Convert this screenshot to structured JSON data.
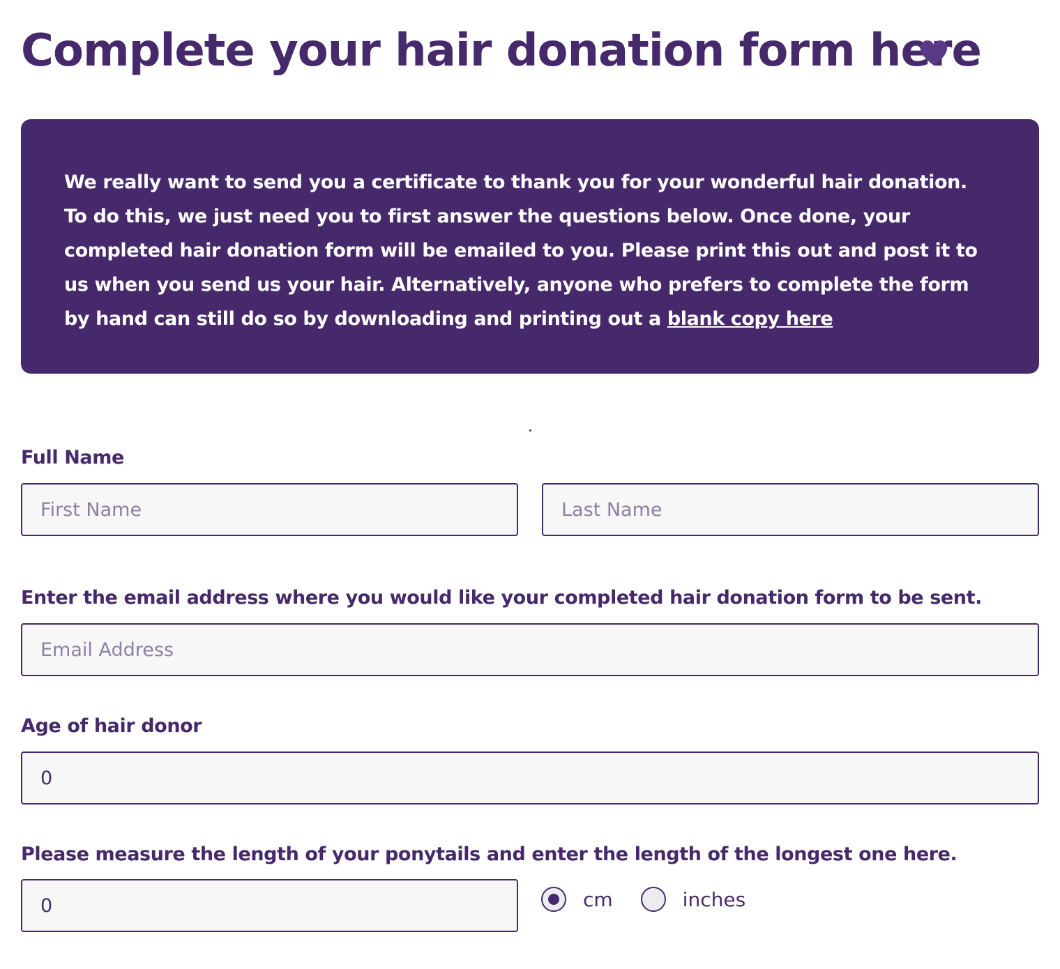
{
  "page": {
    "title": "Complete your hair donation form here"
  },
  "info": {
    "text": "We really want to send you a certificate to thank you for your wonderful hair donation. To do this, we just need you to first answer the questions below. Once done, your completed hair donation form will be emailed to you. Please print this out and post it to us when you send us your hair. Alternatively, anyone who prefers to complete the form by hand can still do so by downloading and printing out a ",
    "link_label": "blank copy here"
  },
  "form": {
    "full_name": {
      "label": "Full Name",
      "first_placeholder": "First Name",
      "last_placeholder": "Last Name"
    },
    "email": {
      "label": "Enter the email address where you would like your completed hair donation form to be sent.",
      "placeholder": "Email Address"
    },
    "age": {
      "label": "Age of hair donor",
      "value": "0"
    },
    "ponytail": {
      "label": "Please measure the length of your ponytails and enter the length of the longest one here.",
      "value": "0",
      "units": [
        {
          "label": "cm",
          "selected": true
        },
        {
          "label": "inches",
          "selected": false
        }
      ]
    }
  },
  "colors": {
    "primary": "#46296a",
    "input_bg": "#f7f7f8",
    "placeholder": "#8e80a2"
  }
}
